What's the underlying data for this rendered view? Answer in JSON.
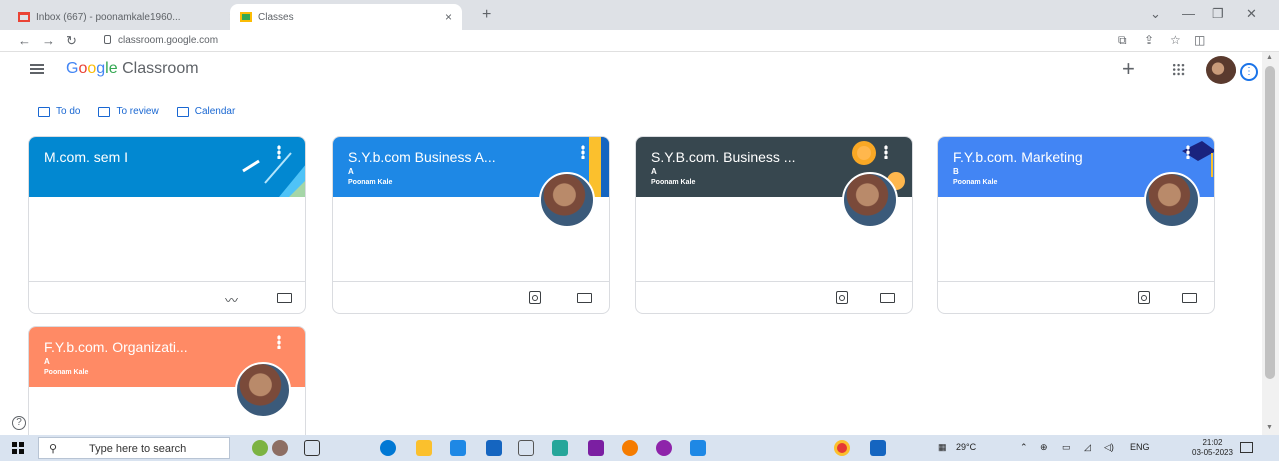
{
  "browser": {
    "tabs": [
      {
        "title": "Inbox (667) - poonamkale1960...",
        "favicon": "gmail-icon",
        "active": false
      },
      {
        "title": "Classes",
        "favicon": "classroom-icon",
        "active": true
      }
    ],
    "url": "classroom.google.com"
  },
  "header": {
    "logo_google": [
      "G",
      "o",
      "o",
      "g",
      "le"
    ],
    "logo_product": "Classroom"
  },
  "nav": [
    {
      "label": "To do",
      "icon": "todo-icon"
    },
    {
      "label": "To review",
      "icon": "review-icon"
    },
    {
      "label": "Calendar",
      "icon": "calendar-icon"
    }
  ],
  "cards": [
    {
      "title": "M.com. sem I",
      "section": "",
      "teacher": "",
      "color": "#0288d1"
    },
    {
      "title": "S.Y.b.com Business A...",
      "section": "A",
      "teacher": "Poonam Kale",
      "color": "#1e88e5"
    },
    {
      "title": "S.Y.B.com. Business ...",
      "section": "A",
      "teacher": "Poonam Kale",
      "color": "#37474f"
    },
    {
      "title": "F.Y.b.com. Marketing",
      "section": "B",
      "teacher": "Poonam Kale",
      "color": "#4285f4"
    },
    {
      "title": "F.Y.b.com. Organizati...",
      "section": "A",
      "teacher": "Poonam Kale",
      "color": "#ff8a65"
    }
  ],
  "taskbar": {
    "search_placeholder": "Type here to search",
    "weather": "29°C",
    "language": "ENG",
    "time": "21:02",
    "date": "03-05-2023"
  }
}
